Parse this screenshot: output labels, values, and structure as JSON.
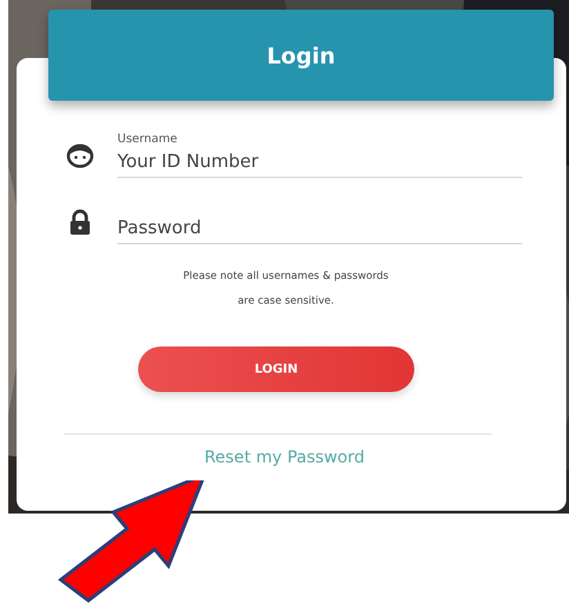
{
  "header": {
    "title": "Login"
  },
  "fields": [
    {
      "kind": "user",
      "label": "Username",
      "placeholder": "Your ID Number"
    },
    {
      "kind": "lock",
      "placeholder": "Password"
    }
  ],
  "note": {
    "lines": [
      "Please note all usernames & passwords",
      "are case sensitive."
    ]
  },
  "login_button": {
    "label": "LOGIN"
  },
  "reset_link": {
    "label": "Reset my Password"
  },
  "annotation": {
    "kind": "arrow"
  }
}
